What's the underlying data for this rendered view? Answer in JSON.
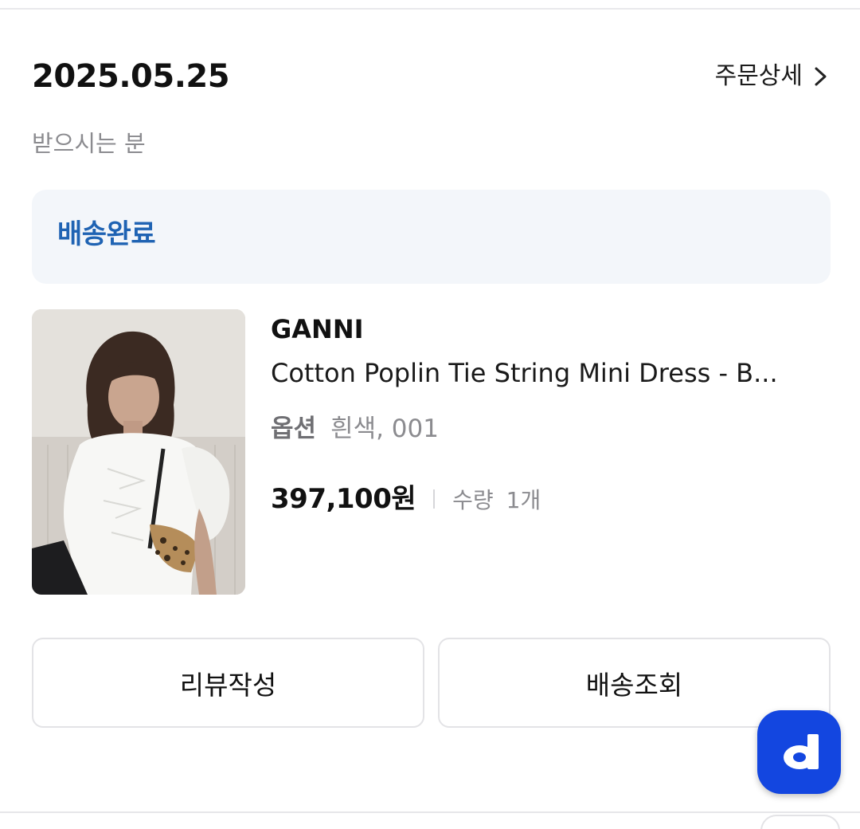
{
  "order": {
    "date": "2025.05.25",
    "detail_link_label": "주문상세",
    "recipient_label": "받으시는 분",
    "status": "배송완료"
  },
  "product": {
    "brand": "GANNI",
    "name": "Cotton Poplin Tie String Mini Dress - B...",
    "option_label": "옵션",
    "option_value": "흰색, 001",
    "price": "397,100원",
    "quantity_label": "수량",
    "quantity_value": "1개"
  },
  "actions": {
    "review_label": "리뷰작성",
    "tracking_label": "배송조회"
  },
  "colors": {
    "status_text": "#1f63b3",
    "status_bg": "#f3f6fa",
    "fab_bg": "#1346e0"
  }
}
